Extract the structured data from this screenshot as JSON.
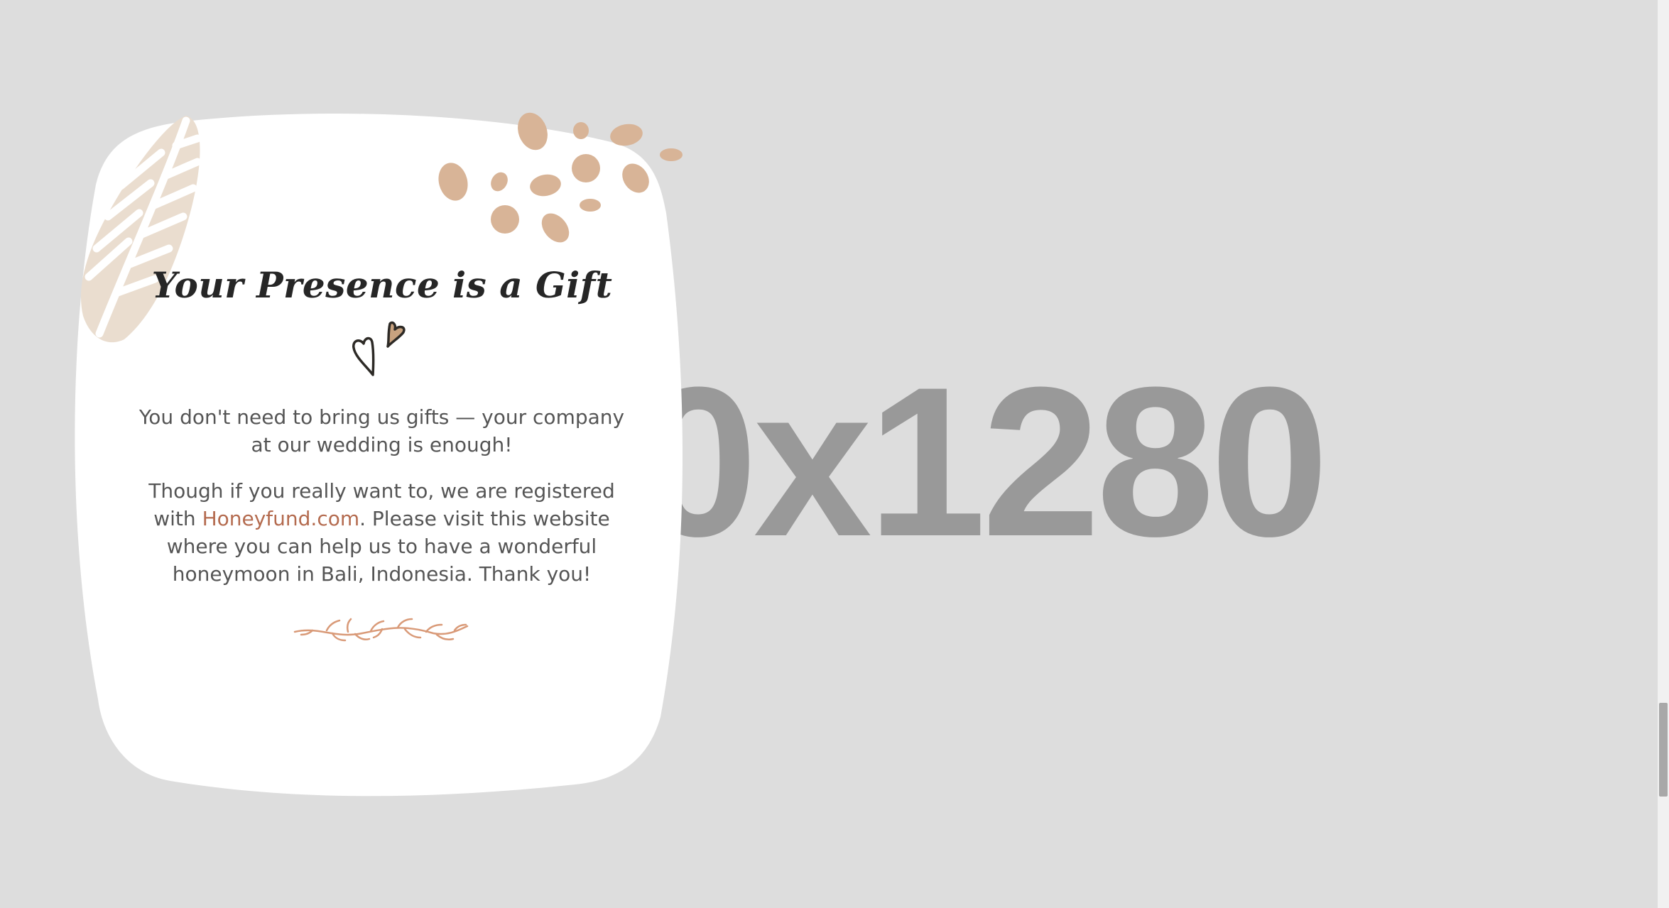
{
  "background": {
    "placeholder_text": "0x1280",
    "color": "#dddddd"
  },
  "card": {
    "title": "Your Presence is a Gift",
    "paragraph1": "You don't need to bring us gifts — your company at our wedding is enough!",
    "paragraph2_before": "Though if you really want to, we are registered with ",
    "link_text": "Honeyfund.com",
    "paragraph2_after": ". Please visit this website where you can help us to have a wonderful honeymoon in Bali, Indonesia. Thank you!",
    "colors": {
      "accent": "#b46b4f",
      "dots": "#d8b497",
      "leaf": "#eaddcf",
      "text": "#555555",
      "title": "#262626"
    }
  },
  "icons": {
    "hearts": "hearts-icon",
    "leaf": "leaf-decoration-icon",
    "dots": "dots-decoration-icon",
    "sprig": "sprig-divider-icon"
  },
  "scrollbar": {
    "position_fraction": 0.86
  }
}
